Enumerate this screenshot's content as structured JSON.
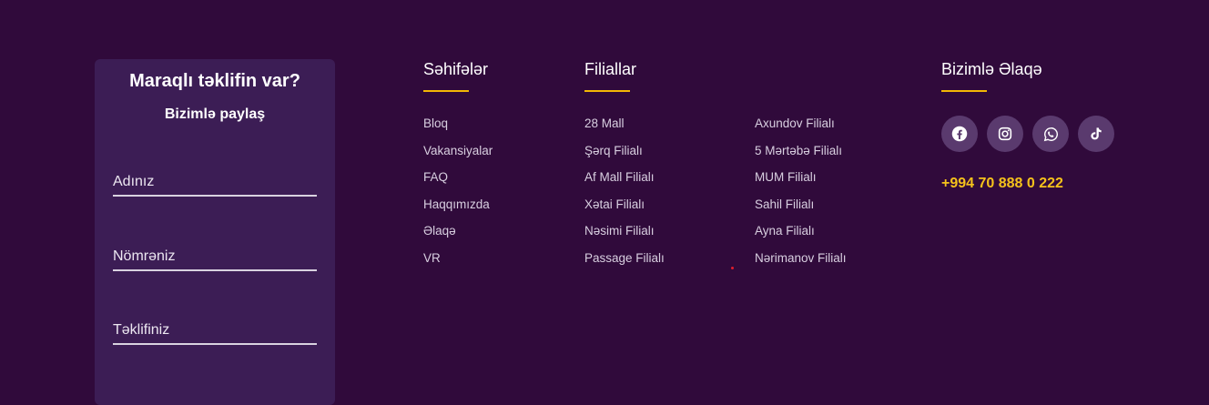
{
  "form": {
    "title": "Maraqlı təklifin var?",
    "subtitle": "Bizimlə paylaş",
    "name_placeholder": "Adınız",
    "phone_placeholder": "Nömrəniz",
    "offer_placeholder": "Təklifiniz"
  },
  "pages": {
    "title": "Səhifələr",
    "items": [
      "Bloq",
      "Vakansiyalar",
      "FAQ",
      "Haqqımızda",
      "Əlaqə",
      "VR"
    ]
  },
  "branches": {
    "title": "Filiallar",
    "col1": [
      "28 Mall",
      "Şərq Filialı",
      "Af Mall Filialı",
      "Xətai Filialı",
      "Nəsimi Filialı",
      "Passage Filialı"
    ],
    "col2": [
      "Axundov Filialı",
      "5 Mərtəbə Filialı",
      "MUM Filialı",
      "Sahil Filialı",
      "Ayna Filialı",
      "Nərimanov Filialı"
    ]
  },
  "contact": {
    "title": "Bizimlə Əlaqə",
    "socials": [
      "facebook-icon",
      "instagram-icon",
      "whatsapp-icon",
      "tiktok-icon"
    ],
    "phone": "+994 70 888 0 222"
  },
  "colors": {
    "background": "#300a3b",
    "card": "#3c1d55",
    "accent": "#f2b705",
    "phone": "#f5c21b"
  }
}
